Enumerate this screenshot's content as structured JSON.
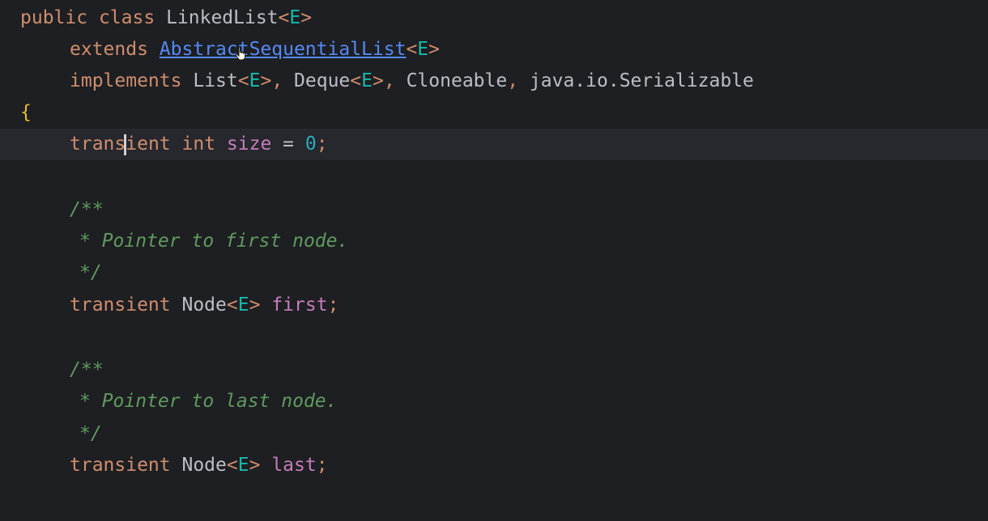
{
  "editor": {
    "lines": {
      "l1": {
        "public": "public",
        "class": "class",
        "name": "LinkedList",
        "lt": "<",
        "tp": "E",
        "gt": ">"
      },
      "l2": {
        "extends": "extends",
        "super": "AbstractSequentialList",
        "lt": "<",
        "tp": "E",
        "gt": ">"
      },
      "l3": {
        "implements": "implements",
        "i1": "List",
        "i1lt": "<",
        "i1tp": "E",
        "i1gt": ">",
        "c1": ",",
        "i2": "Deque",
        "i2lt": "<",
        "i2tp": "E",
        "i2gt": ">",
        "c2": ",",
        "i3": "Cloneable",
        "c3": ",",
        "i4": "java.io.Serializable"
      },
      "l4": {
        "brace": "{"
      },
      "l5": {
        "transient_a": "trans",
        "transient_b": "ient",
        "int": "int",
        "field": "size",
        "eq": "=",
        "num": "0",
        "semi": ";"
      },
      "l7": {
        "doc": "/**"
      },
      "l8": {
        "doc": "* Pointer to first node."
      },
      "l9": {
        "doc": "*/"
      },
      "l10": {
        "transient": "transient",
        "type": "Node",
        "lt": "<",
        "tp": "E",
        "gt": ">",
        "field": "first",
        "semi": ";"
      },
      "l12": {
        "doc": "/**"
      },
      "l13": {
        "doc": "* Pointer to last node."
      },
      "l14": {
        "doc": "*/"
      },
      "l15": {
        "transient": "transient",
        "type": "Node",
        "lt": "<",
        "tp": "E",
        "gt": ">",
        "field": "last",
        "semi": ";"
      }
    },
    "colors": {
      "background": "#1e1f22",
      "current_line": "#26282e",
      "keyword": "#cf8e6d",
      "type_param": "#16baac",
      "field": "#c77dbb",
      "number": "#2aacb8",
      "doc_comment": "#5f9b5f",
      "link": "#548af7"
    },
    "icons": {
      "mouse_pointer": "hand-pointer-icon",
      "text_caret": "text-caret"
    }
  }
}
